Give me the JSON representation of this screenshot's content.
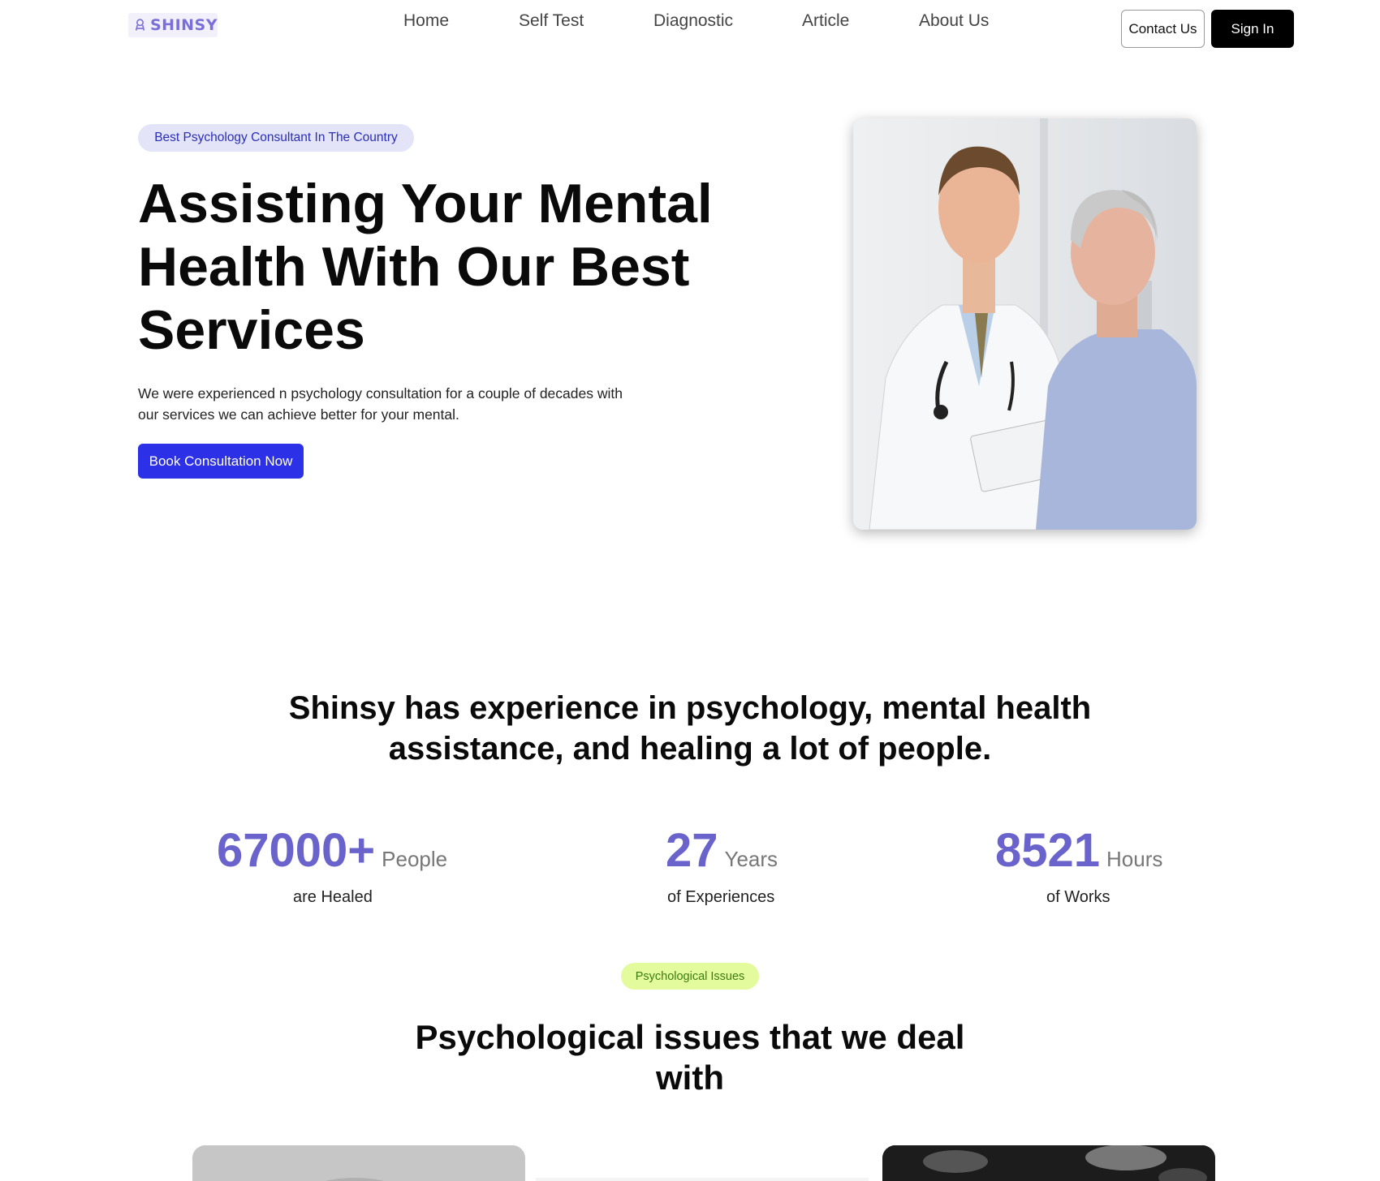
{
  "nav": {
    "logo_text": "SHINSY",
    "links": [
      "Home",
      "Self Test",
      "Diagnostic",
      "Article",
      "About Us"
    ],
    "contact_label": "Contact Us",
    "signin_label": "Sign In"
  },
  "hero": {
    "badge": "Best Psychology Consultant In The Country",
    "title": "Assisting Your Mental Health With Our Best Services",
    "description": "We were experienced n psychology consultation for a couple of decades with our services we can achieve better for your mental.",
    "cta_label": "Book Consultation Now"
  },
  "experience": {
    "title": "Shinsy has experience in psychology, mental health assistance, and healing a lot of people.",
    "stats": [
      {
        "number": "67000+",
        "unit": "People",
        "caption": "are Healed"
      },
      {
        "number": "27",
        "unit": "Years",
        "caption": "of Experiences"
      },
      {
        "number": "8521",
        "unit": "Hours",
        "caption": "of Works"
      }
    ]
  },
  "issues": {
    "badge": "Psychological Issues",
    "title": "Psychological issues that we deal with"
  },
  "colors": {
    "accent_blue": "#2c30e6",
    "stat_purple": "#6a63cc",
    "badge_green": "#e3fb9c",
    "badge_lavender": "#e3e4f8"
  }
}
